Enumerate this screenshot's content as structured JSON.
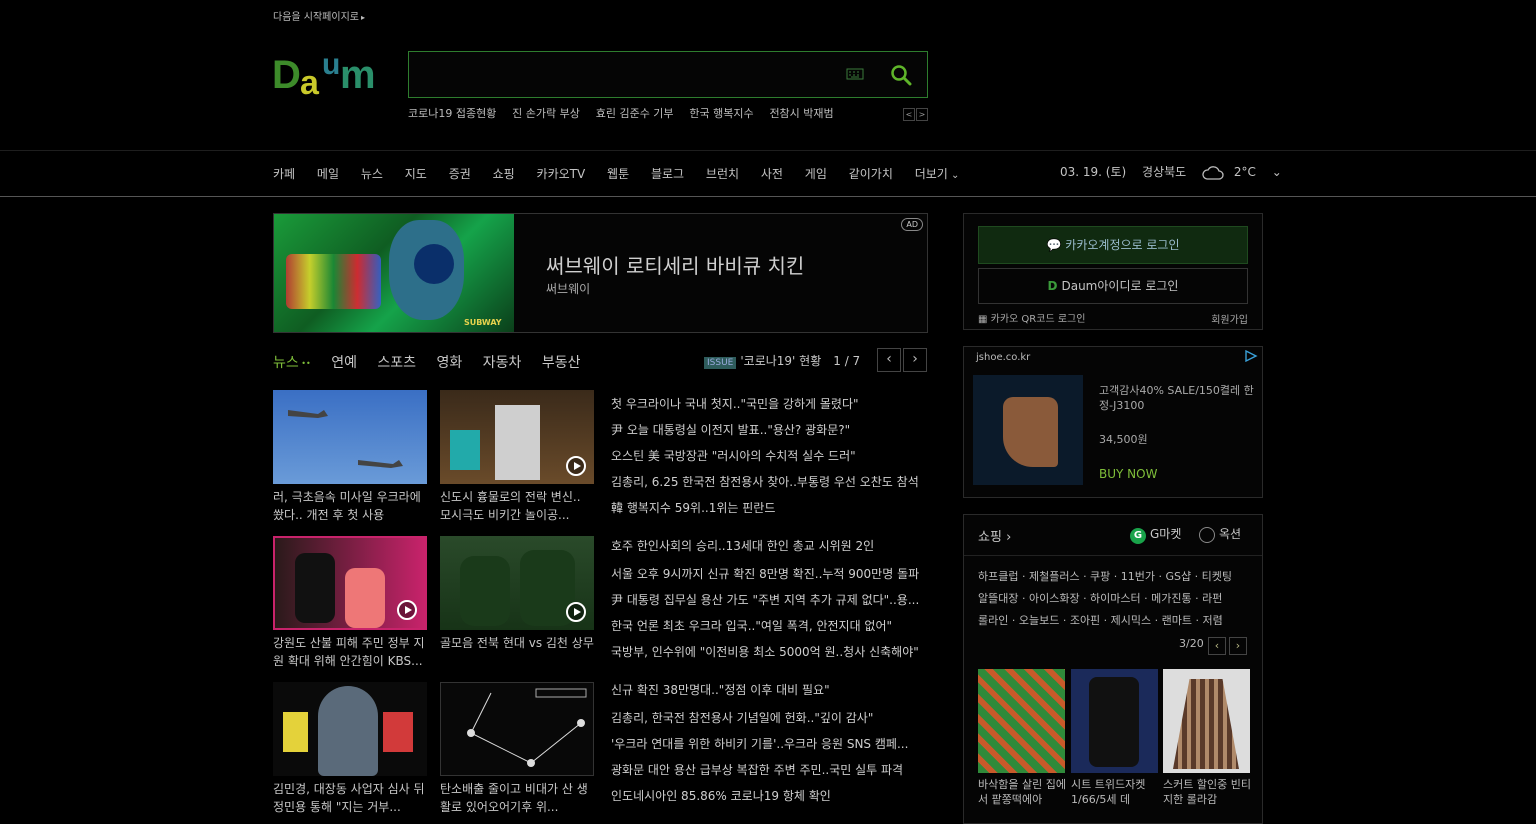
{
  "start_page": "다음을 시작페이지로",
  "search": {
    "placeholder": ""
  },
  "trends": [
    "코로나19 접종현황",
    "진 손가락 부상",
    "효린 김준수 기부",
    "한국 행복지수",
    "전참시 박재범"
  ],
  "gnb": [
    "카페",
    "메일",
    "뉴스",
    "지도",
    "증권",
    "쇼핑",
    "카카오TV",
    "웹툰",
    "블로그",
    "브런치",
    "사전",
    "게임",
    "같이가치",
    "더보기"
  ],
  "weather": {
    "date": "03. 19. (토)",
    "region": "경상북도",
    "temp": "2°C"
  },
  "ad": {
    "title": "써브웨이 로티세리 바비큐 치킨",
    "sub": "써브웨이",
    "badge": "AD",
    "brand": "SUBWAY"
  },
  "news_tabs": [
    "뉴스",
    "연예",
    "스포츠",
    "영화",
    "자동차",
    "부동산"
  ],
  "issue": {
    "tag": "ISSUE",
    "title": "'코로나19' 현황",
    "page": "1 / 7"
  },
  "thumbs": [
    "러, 극초음속 미사일 우크라에 쐈다.. 개전 후 첫 사용",
    "신도시 흉물로의 전락 변신.. 모시극도 비키간 놀이공...",
    "강원도 산불 피해 주민 정부 지원 확대 위해 안간힘이 KBS...",
    "골모음 전북 현대 vs 김천 상무",
    "김민경, 대장동 사업자 심사 뒤 정민용 통해 \"지는 거부...",
    "탄소배출 줄이고 비대가 산 생활로 있어오어기후 위..."
  ],
  "headlines": [
    "첫 우크라이나 국내 첫지..\"국민을 강하게 몰렸다\"",
    "尹 오늘 대통령실 이전지 발표..\"용산? 광화문?\"",
    "오스틴 美 국방장관 \"러시아의 수치적 실수 드러\"",
    "김총리, 6.25 한국전 참전용사 찾아..부통령 우선 오찬도 참석",
    "韓 행복지수 59위..1위는 핀란드",
    "호주 한인사회의 승리..13세대 한인 총교 시위원 2인",
    "서울 오후 9시까지 신규 확진 8만명 확진..누적 900만명 돌파",
    "尹 대통령 집무실 용산 가도 \"주변 지역 추가 규제 없다\"..용...",
    "한국 언론 최초 우크라 입국..\"여일 폭격, 안전지대 없어\"",
    "국방부, 인수위에 \"이전비용 최소 5000억 원..청사 신축해야\"",
    "신규 확진 38만명대..\"정점 이후 대비 필요\"",
    "김총리, 한국전 참전용사 기념일에 헌화..\"깊이 감사\"",
    "'우크라 연대를 위한 하비키 기를'..우크라 응원 SNS 캠페...",
    "광화문 대안 용산 급부상 복잡한 주변 주민..국민 실투 파격",
    "인도네시아인 85.86% 코로나19 항체 확인"
  ],
  "login": {
    "kakao": "카카오계정으로 로그인",
    "daum": "Daum아이디로 로그인",
    "qr": "카카오 QR코드 로그인",
    "join": "회원가입"
  },
  "side_ad": {
    "domain": "jshoe.co.kr",
    "title": "고객감사40% SALE/150켤레 한정-J3100",
    "price": "34,500원",
    "buy": "BUY NOW"
  },
  "shopping": {
    "title": "쇼핑",
    "gmarket": "G마켓",
    "auction": "옥션",
    "keywords": [
      "하프클럽 · 제철플러스 · 쿠팡 · 11번가 · GS샵 · 티켓팅",
      "알뜰대장 · 아이스화장 · 하이마스터 · 메가진통 · 라펀",
      "롤라인 · 오늘보드 · 조아핀 · 제시믹스 · 랜마트 · 저렴"
    ],
    "page": "3/20",
    "products": [
      "바삭함을 살린 집에서 팥쫑떡에아",
      "시트 트위드자켓 1/66/5세 데",
      "스커트 할인중 빈티지한 롤라감"
    ]
  }
}
